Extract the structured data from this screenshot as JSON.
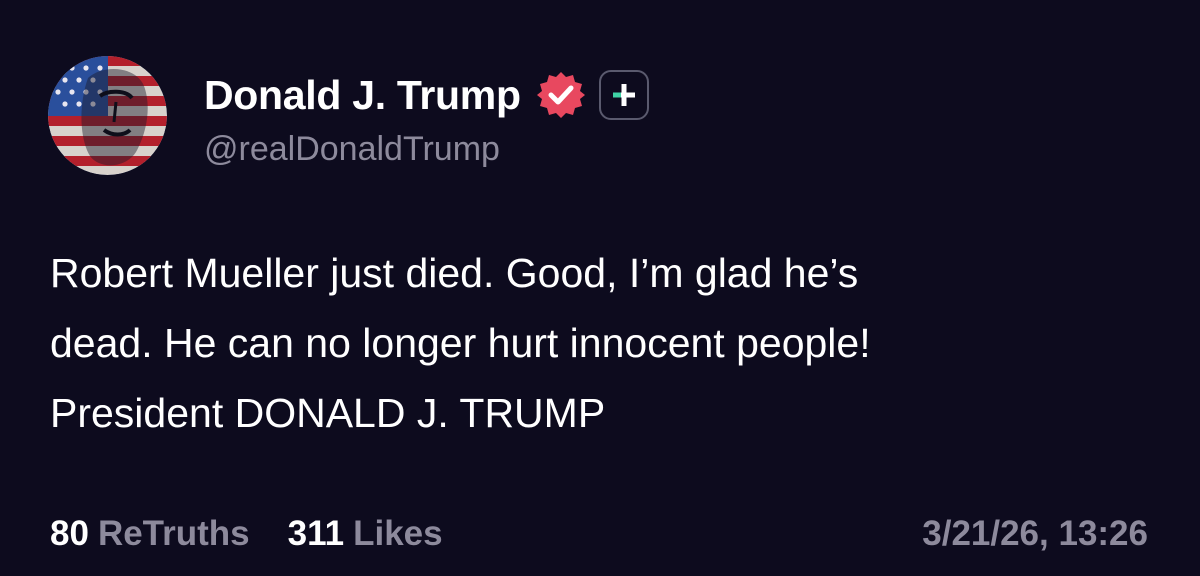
{
  "post": {
    "author": {
      "display_name": "Donald J. Trump",
      "handle": "@realDonaldTrump",
      "avatar_icon": "flag-portrait-avatar",
      "verified_icon": "verified-badge-icon",
      "plus_icon": "plus-badge-icon"
    },
    "body_lines": [
      "Robert Mueller just died. Good, I’m glad he’s",
      "dead. He can no longer hurt innocent people!",
      "President DONALD J. TRUMP"
    ],
    "stats": {
      "retruths_count": "80",
      "retruths_label": "ReTruths",
      "likes_count": "311",
      "likes_label": "Likes"
    },
    "timestamp": "3/21/26, 13:26"
  },
  "colors": {
    "background": "#0d0b1e",
    "text_primary": "#ffffff",
    "text_secondary": "#8d8a9c",
    "verified_badge": "#e8485f",
    "plus_accent": "#3fd3a6",
    "plus_border": "#5a5a6e"
  }
}
